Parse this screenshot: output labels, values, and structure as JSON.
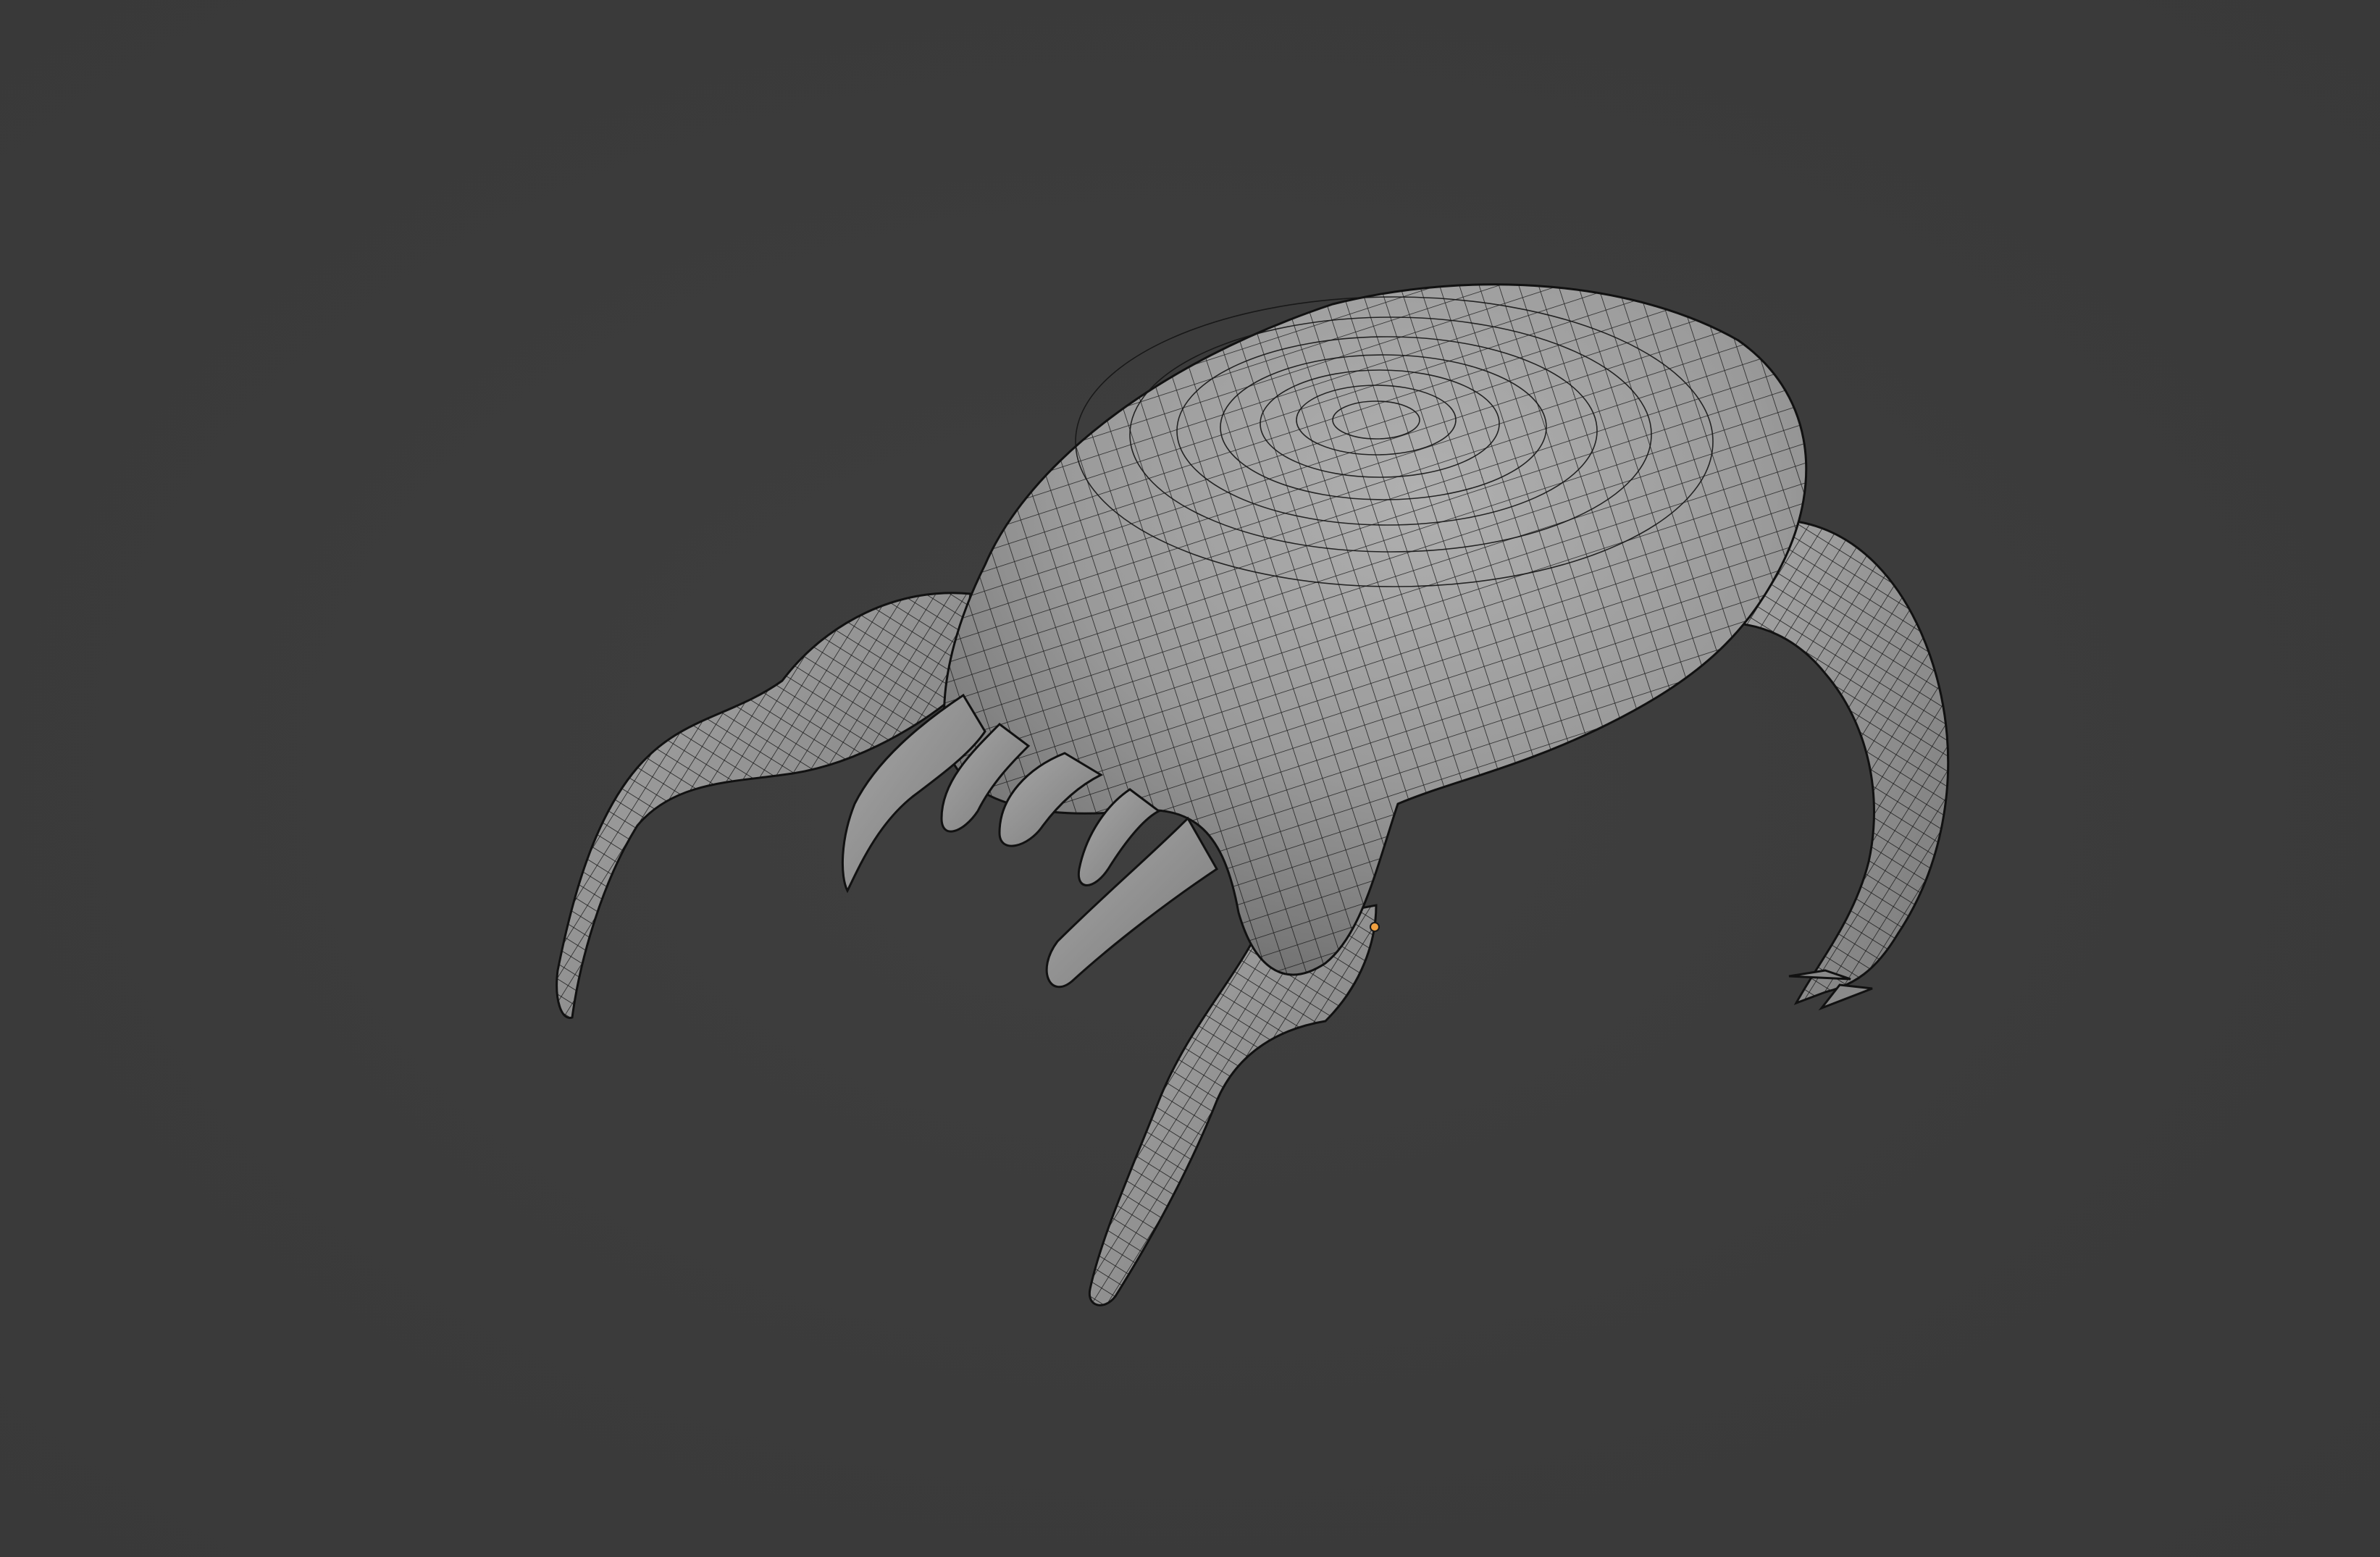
{
  "viewport": {
    "mode": "3D Viewport",
    "shading": "solid-wireframe",
    "background_color": "#3c3c3c"
  },
  "model": {
    "name": "",
    "surface_color": "#9a9a9a",
    "wire_color": "#111111",
    "origin_color": "#f0a040"
  }
}
